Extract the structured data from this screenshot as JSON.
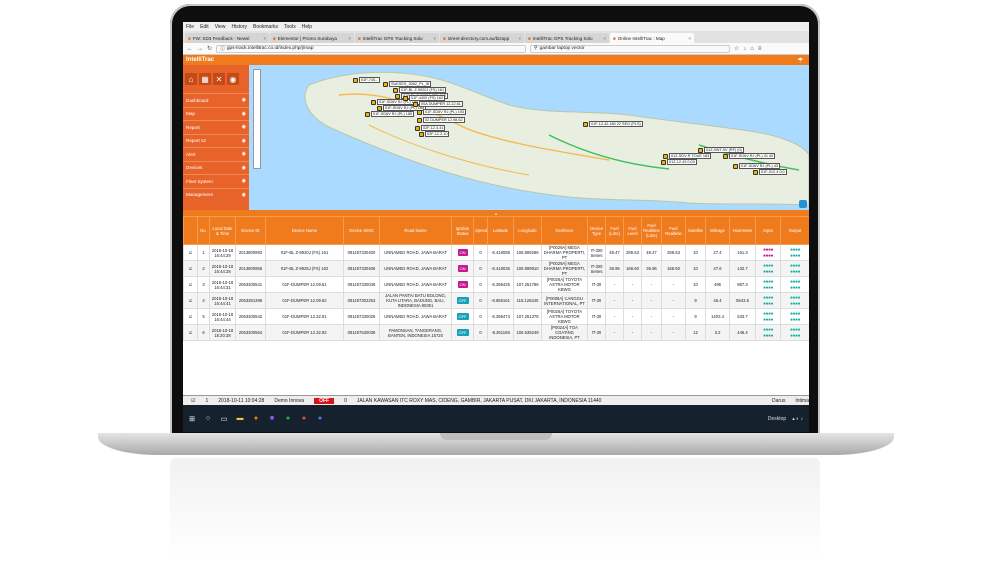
{
  "menu": [
    "File",
    "Edit",
    "View",
    "History",
    "Bookmarks",
    "Tools",
    "Help"
  ],
  "tabs": [
    {
      "label": "FW: SD3 Feedback - Newsl",
      "active": false
    },
    {
      "label": "Elementor | Promo Surabaya",
      "active": false
    },
    {
      "label": "IntelliTrac GPS Tracking Solu",
      "active": false
    },
    {
      "label": "street-directory.com.au/bizapp",
      "active": false
    },
    {
      "label": "IntelliTrac GPS Tracking Solu",
      "active": false
    },
    {
      "label": "Online IntelliTrac : Map",
      "active": true
    }
  ],
  "url": "gps-track.intellitrac.co.id/index.php/j/map",
  "search": "gambar laptop vector",
  "app": {
    "logo": "IntelliTrac"
  },
  "sidebar": [
    "Dashboard",
    "Map",
    "Report",
    "Report v2",
    "Alert",
    "Devices",
    "Fleet System",
    "Management"
  ],
  "map_labels": [
    {
      "t": "01F-745..."
    },
    {
      "t": "SUKSES_3062_PL_I8"
    },
    {
      "t": "01F-BL Z-9920J (FS) 161"
    },
    {
      "t": "01F-BL Z-9925J (FS) 162"
    },
    {
      "t": "01F-SD6V RJ (PL) 184"
    },
    {
      "t": "01F-SD6V RJ (PL) 185"
    },
    {
      "t": "01F-SD6V RJ (PL) 189"
    },
    {
      "t": "01F-4400 (FS) 162"
    },
    {
      "t": "00A DUMPER 12.22.61"
    },
    {
      "t": "01F-12.42.180 22 SEG (PLS)"
    },
    {
      "t": "01F-SD6V RJ (PL) 193"
    },
    {
      "t": "02 DUMPER 12.98.62"
    },
    {
      "t": "02F-12.4.41"
    },
    {
      "t": "02F-12.2.10"
    },
    {
      "t": "01Z-12.43 0:03"
    },
    {
      "t": "01Z-SDV R TOUE 183"
    },
    {
      "t": "01Z-0WT-9V (RF) (0)"
    },
    {
      "t": "01F-SD6V RJ (PL) 41 40"
    },
    {
      "t": "01F-SD6V RJ (PL) 43"
    },
    {
      "t": "01F-012.4 0:0"
    }
  ],
  "columns": [
    "",
    "No.",
    "Local Date & Time",
    "Device ID",
    "Device Name",
    "Device SIMC",
    "Road Name",
    "Ignition Status",
    "Speed",
    "Latitude",
    "Longitude",
    "Geofence",
    "Device Type",
    "Fuel (Litre)",
    "Fuel Level",
    "Fuel Realtime (Litre)",
    "Fuel Realtime",
    "Satellite",
    "Mileage",
    "Hourmeter",
    "Input",
    "Output"
  ],
  "rows": [
    {
      "no": "1",
      "time": "2018-10-18 16:44:29",
      "id": "2013800993",
      "name": "01F-BL Z-9920J (FS) 161",
      "sim": "081197330400",
      "road": "UNNAMED ROAD, JAWA BARAT",
      "ign": "ON",
      "speed": "0",
      "lat": "-6.416085",
      "lon": "106.899286",
      "geo": "[P0029A] MEGA DHARMA PROPERTI, PT",
      "type": "IT-300 Series",
      "fuel": "48.47",
      "lvl": "289.63",
      "fr": "48.47",
      "frt": "289.63",
      "sat": "10",
      "mil": "27.4",
      "hm": "161.3",
      "inp": "pink"
    },
    {
      "no": "2",
      "time": "2018-10-18 16:44:28",
      "id": "2013800956",
      "name": "01F-BL Z-9925J (FS) 162",
      "sim": "081197330406",
      "road": "UNNAMED ROAD, JAWA BARAT",
      "ign": "ON",
      "speed": "0",
      "lat": "-6.416036",
      "lon": "106.899910",
      "geo": "[P0029A] MEGA DHARMA PROPERTI, PT",
      "type": "IT-300 Series",
      "fuel": "36.96",
      "lvl": "166.60",
      "fr": "36.96",
      "frt": "166.60",
      "sat": "10",
      "mil": "47.6",
      "hm": "132.7",
      "inp": "teal"
    },
    {
      "no": "3",
      "time": "2018-10-18 16:44:31",
      "id": "2063300541",
      "name": "01F-DUMPER 12.09.61",
      "sim": "081197330046",
      "road": "UNNAMED ROAD, JAWA BARAT",
      "ign": "ON",
      "speed": "0",
      "lat": "-6.395425",
      "lon": "107.251786",
      "geo": "[P0026A] TOYOTA ASTRA MOTOR KBWG",
      "type": "IT-30",
      "fuel": "-",
      "lvl": "-",
      "fr": "-",
      "frt": "-",
      "sat": "10",
      "mil": "496",
      "hm": "867.3",
      "inp": "teal"
    },
    {
      "no": "4",
      "time": "2018-10-18 16:44:41",
      "id": "2063381398",
      "name": "01F-DUMPER 12.09.62",
      "sim": "081197302253",
      "road": "JALAN PANTAI BATU BOLONG, KUTA UTARA, BADUNG, BALI, INDONESIA 80361",
      "ign": "OFF",
      "speed": "0",
      "lat": "-8.656161",
      "lon": "115.126345",
      "geo": "[P0008A] CANGGU INTERNATIONAL, PT",
      "type": "IT-30",
      "fuel": "-",
      "lvl": "-",
      "fr": "-",
      "frt": "-",
      "sat": "9",
      "mil": "46.4",
      "hm": "5943.6",
      "inp": "teal"
    },
    {
      "no": "5",
      "time": "2018-10-18 16:44:44",
      "id": "2063300542",
      "name": "01F-DUMPER 12.32.91",
      "sim": "081197330026",
      "road": "UNNAMED ROAD, JAWA BARAT",
      "ign": "OFF",
      "speed": "0",
      "lat": "-6.395474",
      "lon": "107.251378",
      "geo": "[P0026A] TOYOTA ASTRA MOTOR KBWG",
      "type": "IT-30",
      "fuel": "-",
      "lvl": "-",
      "fr": "-",
      "frt": "-",
      "sat": "9",
      "mil": "1403.4",
      "hm": "533.7",
      "inp": "teal"
    },
    {
      "no": "6",
      "time": "2018-10-18 16:20:38",
      "id": "2063300564",
      "name": "01F-DUMPER 12.32.92",
      "sim": "081197530036",
      "road": "PAMONSAN, TANGERANG, BANTEN, INDONESIA 15720",
      "ign": "OFF",
      "speed": "0",
      "lat": "-6.261168",
      "lon": "106.539249",
      "geo": "[P0024A] TOA COATING INDONESIA, PT",
      "type": "IT-30",
      "fuel": "-",
      "lvl": "-",
      "fr": "-",
      "frt": "-",
      "sat": "12",
      "mil": "3.2",
      "hm": "446.4",
      "inp": "teal"
    }
  ],
  "status": {
    "no": "1",
    "time": "2018-10-11 10:04:28",
    "name": "Demo Innova",
    "ign": "OFF",
    "speed": "0",
    "address": "JALAN KAWASAN ITC ROXY MAS, CIDENG, GAMBIR, JAKARTA PUSAT, DKI JAKARTA, INDONESIA 11440",
    "driver": "Darus",
    "extra": "Intima"
  },
  "taskbar": {
    "desktop": "Desktop"
  }
}
